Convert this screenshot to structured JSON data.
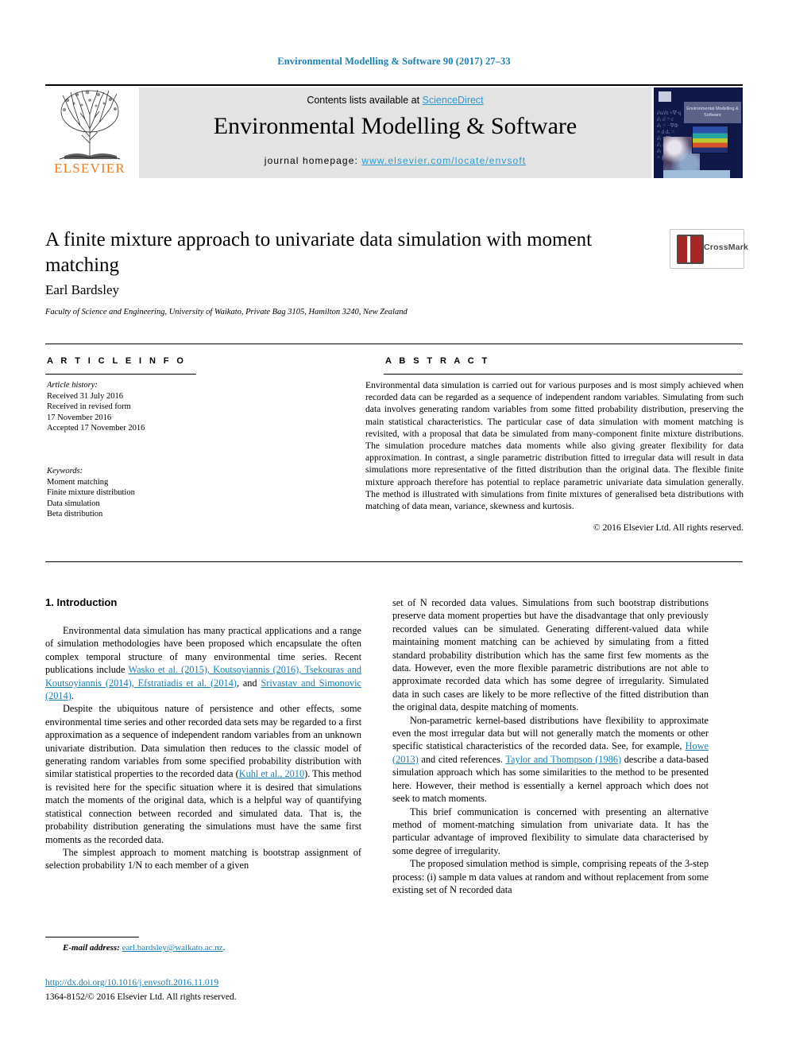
{
  "running_head": "Environmental Modelling & Software 90 (2017) 27–33",
  "masthead": {
    "contents_prefix": "Contents lists available at ",
    "contents_link": "ScienceDirect",
    "journal_title": "Environmental Modelling & Software",
    "homepage_prefix": "journal homepage: ",
    "homepage_url": "www.elsevier.com/locate/envsoft",
    "publisher_name": "ELSEVIER",
    "cover_title": "Environmental Modelling & Software"
  },
  "article": {
    "title": "A finite mixture approach to univariate data simulation with moment matching",
    "author": "Earl Bardsley",
    "affiliation": "Faculty of Science and Engineering, University of Waikato, Private Bag 3105, Hamilton 3240, New Zealand",
    "crossmark_label": "CrossMark"
  },
  "info": {
    "heading": "A R T I C L E   I N F O",
    "history_label": "Article history:",
    "history_lines": [
      "Received 31 July 2016",
      "Received in revised form",
      "17 November 2016",
      "Accepted 17 November 2016"
    ],
    "keywords_label": "Keywords:",
    "keywords": [
      "Moment matching",
      "Finite mixture distribution",
      "Data simulation",
      "Beta distribution"
    ]
  },
  "abstract": {
    "heading": "A B S T R A C T",
    "text": "Environmental data simulation is carried out for various purposes and is most simply achieved when recorded data can be regarded as a sequence of independent random variables. Simulating from such data involves generating random variables from some fitted probability distribution, preserving the main statistical characteristics. The particular case of data simulation with moment matching is revisited, with a proposal that data be simulated from many-component finite mixture distributions. The simulation procedure matches data moments while also giving greater flexibility for data approximation. In contrast, a single parametric distribution fitted to irregular data will result in data simulations more representative of the fitted distribution than the original data. The flexible finite mixture approach therefore has potential to replace parametric univariate data simulation generally. The method is illustrated with simulations from finite mixtures of generalised beta distributions with matching of data mean, variance, skewness and kurtosis.",
    "copyright": "© 2016 Elsevier Ltd. All rights reserved."
  },
  "body": {
    "section_1_heading": "1. Introduction",
    "left_paragraphs": [
      {
        "segments": [
          {
            "t": "Environmental data simulation has many practical applications and a range of simulation methodologies have been proposed which encapsulate the often complex temporal structure of many environmental time series. Recent publications include ",
            "link": false
          },
          {
            "t": "Wasko et al. (2015), Koutsoyiannis (2016), Tsekouras and Koutsoyiannis (2014), Efstratiadis et al. (2014)",
            "link": true
          },
          {
            "t": ", and ",
            "link": false
          },
          {
            "t": "Srivastav and Simonovic (2014)",
            "link": true
          },
          {
            "t": ".",
            "link": false
          }
        ]
      },
      {
        "segments": [
          {
            "t": "Despite the ubiquitous nature of persistence and other effects, some environmental time series and other recorded data sets may be regarded to a first approximation as a sequence of independent random variables from an unknown univariate distribution. Data simulation then reduces to the classic model of generating random variables from some specified probability distribution with similar statistical properties to the recorded data (",
            "link": false
          },
          {
            "t": "Kuhl et al., 2010",
            "link": true
          },
          {
            "t": "). This method is revisited here for the specific situation where it is desired that simulations match the moments of the original data, which is a helpful way of quantifying statistical connection between recorded and simulated data. That is, the probability distribution generating the simulations must have the same first moments as the recorded data.",
            "link": false
          }
        ]
      },
      {
        "segments": [
          {
            "t": "The simplest approach to moment matching is bootstrap assignment of selection probability 1/N to each member of a given",
            "link": false
          }
        ]
      }
    ],
    "right_paragraphs": [
      {
        "indent": false,
        "segments": [
          {
            "t": "set of N recorded data values. Simulations from such bootstrap distributions preserve data moment properties but have the disadvantage that only previously recorded values can be simulated. Generating different-valued data while maintaining moment matching can be achieved by simulating from a fitted standard probability distribution which has the same first few moments as the data. However, even the more flexible parametric distributions are not able to approximate recorded data which has some degree of irregularity. Simulated data in such cases are likely to be more reflective of the fitted distribution than the original data, despite matching of moments.",
            "link": false
          }
        ]
      },
      {
        "indent": true,
        "segments": [
          {
            "t": "Non-parametric kernel-based distributions have flexibility to approximate even the most irregular data but will not generally match the moments or other specific statistical characteristics of the recorded data. See, for example, ",
            "link": false
          },
          {
            "t": "Howe (2013)",
            "link": true
          },
          {
            "t": " and cited references. ",
            "link": false
          },
          {
            "t": "Taylor and Thompson (1986)",
            "link": true
          },
          {
            "t": " describe a data-based simulation approach which has some similarities to the method to be presented here. However, their method is essentially a kernel approach which does not seek to match moments.",
            "link": false
          }
        ]
      },
      {
        "indent": true,
        "segments": [
          {
            "t": "This brief communication is concerned with presenting an alternative method of moment-matching simulation from univariate data. It has the particular advantage of improved flexibility to simulate data characterised by some degree of irregularity.",
            "link": false
          }
        ]
      },
      {
        "indent": true,
        "segments": [
          {
            "t": "The proposed simulation method is simple, comprising repeats of the 3-step process: (i) sample m data values at random and without replacement from some existing set of N recorded data",
            "link": false
          }
        ]
      }
    ]
  },
  "footer": {
    "email_label": "E-mail address:",
    "email": "earl.bardsley@waikato.ac.nz",
    "email_suffix": ".",
    "doi": "http://dx.doi.org/10.1016/j.envsoft.2016.11.019",
    "issn": "1364-8152/© 2016 Elsevier Ltd. All rights reserved."
  },
  "colors": {
    "link": "#1a7fb5",
    "sciencedirect": "#2a9ad0",
    "elsevier_orange": "#f07c1f",
    "masthead_bg": "#e3e3e3",
    "cover_bg": "#10184a"
  }
}
